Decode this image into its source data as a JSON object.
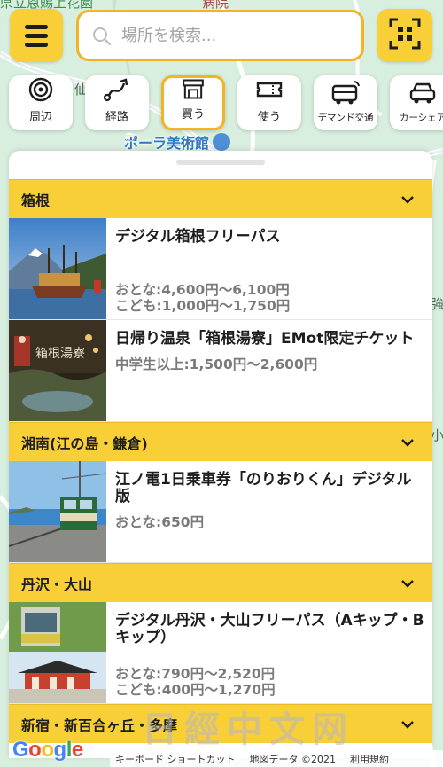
{
  "map": {
    "labels": [
      "病院",
      "仙",
      "強",
      "小"
    ],
    "top_left_label": "県立恩賜上花園",
    "poi": "ポーラ美術館",
    "poi_icon": "museum-icon"
  },
  "search": {
    "placeholder": "場所を検索..."
  },
  "categories": [
    {
      "label": "周辺",
      "icon": "nearby-icon"
    },
    {
      "label": "経路",
      "icon": "route-icon"
    },
    {
      "label": "買う",
      "icon": "shop-icon",
      "active": true
    },
    {
      "label": "使う",
      "icon": "ticket-icon"
    },
    {
      "label": "デマンド交通",
      "icon": "on-demand-bus-icon"
    },
    {
      "label": "カーシェア",
      "icon": "car-share-icon"
    }
  ],
  "sections": [
    {
      "title": "箱根",
      "items": [
        {
          "title": "デジタル箱根フリーパス",
          "prices": [
            "おとな:4,600円〜6,100円",
            "こども:1,000円〜1,750円"
          ]
        },
        {
          "title": "日帰り温泉「箱根湯寮」EMot限定チケット",
          "prices": [
            "中学生以上:1,500円〜2,600円"
          ]
        }
      ]
    },
    {
      "title": "湘南(江の島・鎌倉)",
      "items": [
        {
          "title": "江ノ電1日乗車券「のりおりくん」デジタル版",
          "prices": [
            "おとな:650円"
          ]
        }
      ]
    },
    {
      "title": "丹沢・大山",
      "items": [
        {
          "title": "デジタル丹沢・大山フリーパス（Aキップ・Bキップ）",
          "prices": [
            "おとな:790円〜2,520円",
            "こども:400円〜1,270円"
          ]
        }
      ]
    },
    {
      "title": "新宿・新百合ヶ丘・多摩"
    }
  ],
  "thumb_text": "箱根湯寮",
  "footer": {
    "google": "Google",
    "shortcuts": "キーボード ショートカット",
    "map_data": "地図データ ©2021",
    "terms": "利用規約"
  },
  "watermark": "日經中文网",
  "colors": {
    "accent_yellow": "#f8cf37",
    "accent_border": "#f3b322",
    "price_gray": "#7a7a7a",
    "map_green": "#d8eede"
  }
}
